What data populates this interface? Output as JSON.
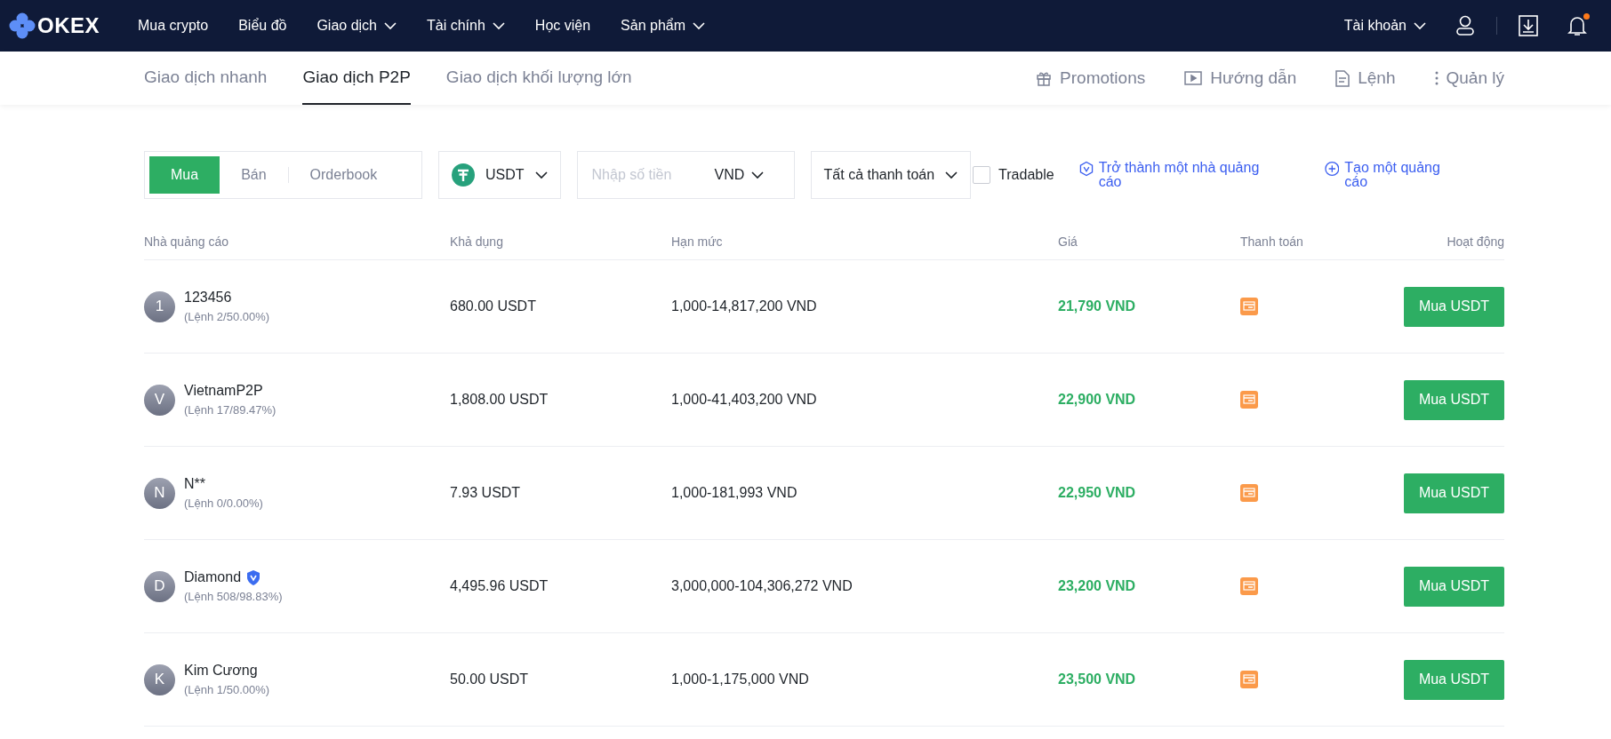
{
  "topbar": {
    "logo": "OKEX",
    "nav": [
      {
        "label": "Mua crypto",
        "dropdown": false
      },
      {
        "label": "Biểu đồ",
        "dropdown": false
      },
      {
        "label": "Giao dịch",
        "dropdown": true
      },
      {
        "label": "Tài chính",
        "dropdown": true
      },
      {
        "label": "Học viện",
        "dropdown": false
      },
      {
        "label": "Sản phẩm",
        "dropdown": true
      }
    ],
    "account": "Tài khoản",
    "notification_dot": true
  },
  "subnav": {
    "tabs": [
      {
        "label": "Giao dịch nhanh",
        "selected": false
      },
      {
        "label": "Giao dịch P2P",
        "selected": true
      },
      {
        "label": "Giao dịch khối lượng lớn",
        "selected": false
      }
    ],
    "actions": [
      {
        "kind": "gift",
        "label": "Promotions"
      },
      {
        "kind": "video",
        "label": "Hướng dẫn"
      },
      {
        "kind": "document",
        "label": "Lệnh"
      },
      {
        "kind": "more",
        "label": "Quản lý"
      }
    ]
  },
  "filters": {
    "modes": [
      {
        "label": "Mua",
        "selected": true
      },
      {
        "label": "Bán",
        "selected": false
      },
      {
        "label": "Orderbook",
        "selected": false
      }
    ],
    "coin": "USDT",
    "amount": {
      "placeholder": "Nhập số tiền",
      "currency": "VND"
    },
    "payment": "Tất cả thanh toán",
    "tradable": {
      "label": "Tradable",
      "checked": false
    },
    "links": [
      {
        "kind": "shield",
        "label": "Trở thành một nhà quảng cáo"
      },
      {
        "kind": "plus",
        "label": "Tạo một quảng cáo"
      }
    ]
  },
  "table": {
    "columns": [
      "Nhà quảng cáo",
      "Khả dụng",
      "Hạn mức",
      "Giá",
      "Thanh toán",
      "Hoạt động"
    ],
    "rows": [
      {
        "initial": "1",
        "name": "123456",
        "verified": false,
        "orders": "(Lệnh 2/50.00%)",
        "available": "680.00 USDT",
        "limit": "1,000-14,817,200 VND",
        "price": "21,790 VND",
        "action": "Mua USDT"
      },
      {
        "initial": "V",
        "name": "VietnamP2P",
        "verified": false,
        "orders": "(Lệnh 17/89.47%)",
        "available": "1,808.00 USDT",
        "limit": "1,000-41,403,200 VND",
        "price": "22,900 VND",
        "action": "Mua USDT"
      },
      {
        "initial": "N",
        "name": "N**",
        "verified": false,
        "orders": "(Lệnh 0/0.00%)",
        "available": "7.93 USDT",
        "limit": "1,000-181,993 VND",
        "price": "22,950 VND",
        "action": "Mua USDT"
      },
      {
        "initial": "D",
        "name": "Diamond",
        "verified": true,
        "orders": "(Lệnh 508/98.83%)",
        "available": "4,495.96 USDT",
        "limit": "3,000,000-104,306,272 VND",
        "price": "23,200 VND",
        "action": "Mua USDT"
      },
      {
        "initial": "K",
        "name": "Kim Cương",
        "verified": false,
        "orders": "(Lệnh 1/50.00%)",
        "available": "50.00 USDT",
        "limit": "1,000-1,175,000 VND",
        "price": "23,500 VND",
        "action": "Mua USDT"
      }
    ]
  }
}
